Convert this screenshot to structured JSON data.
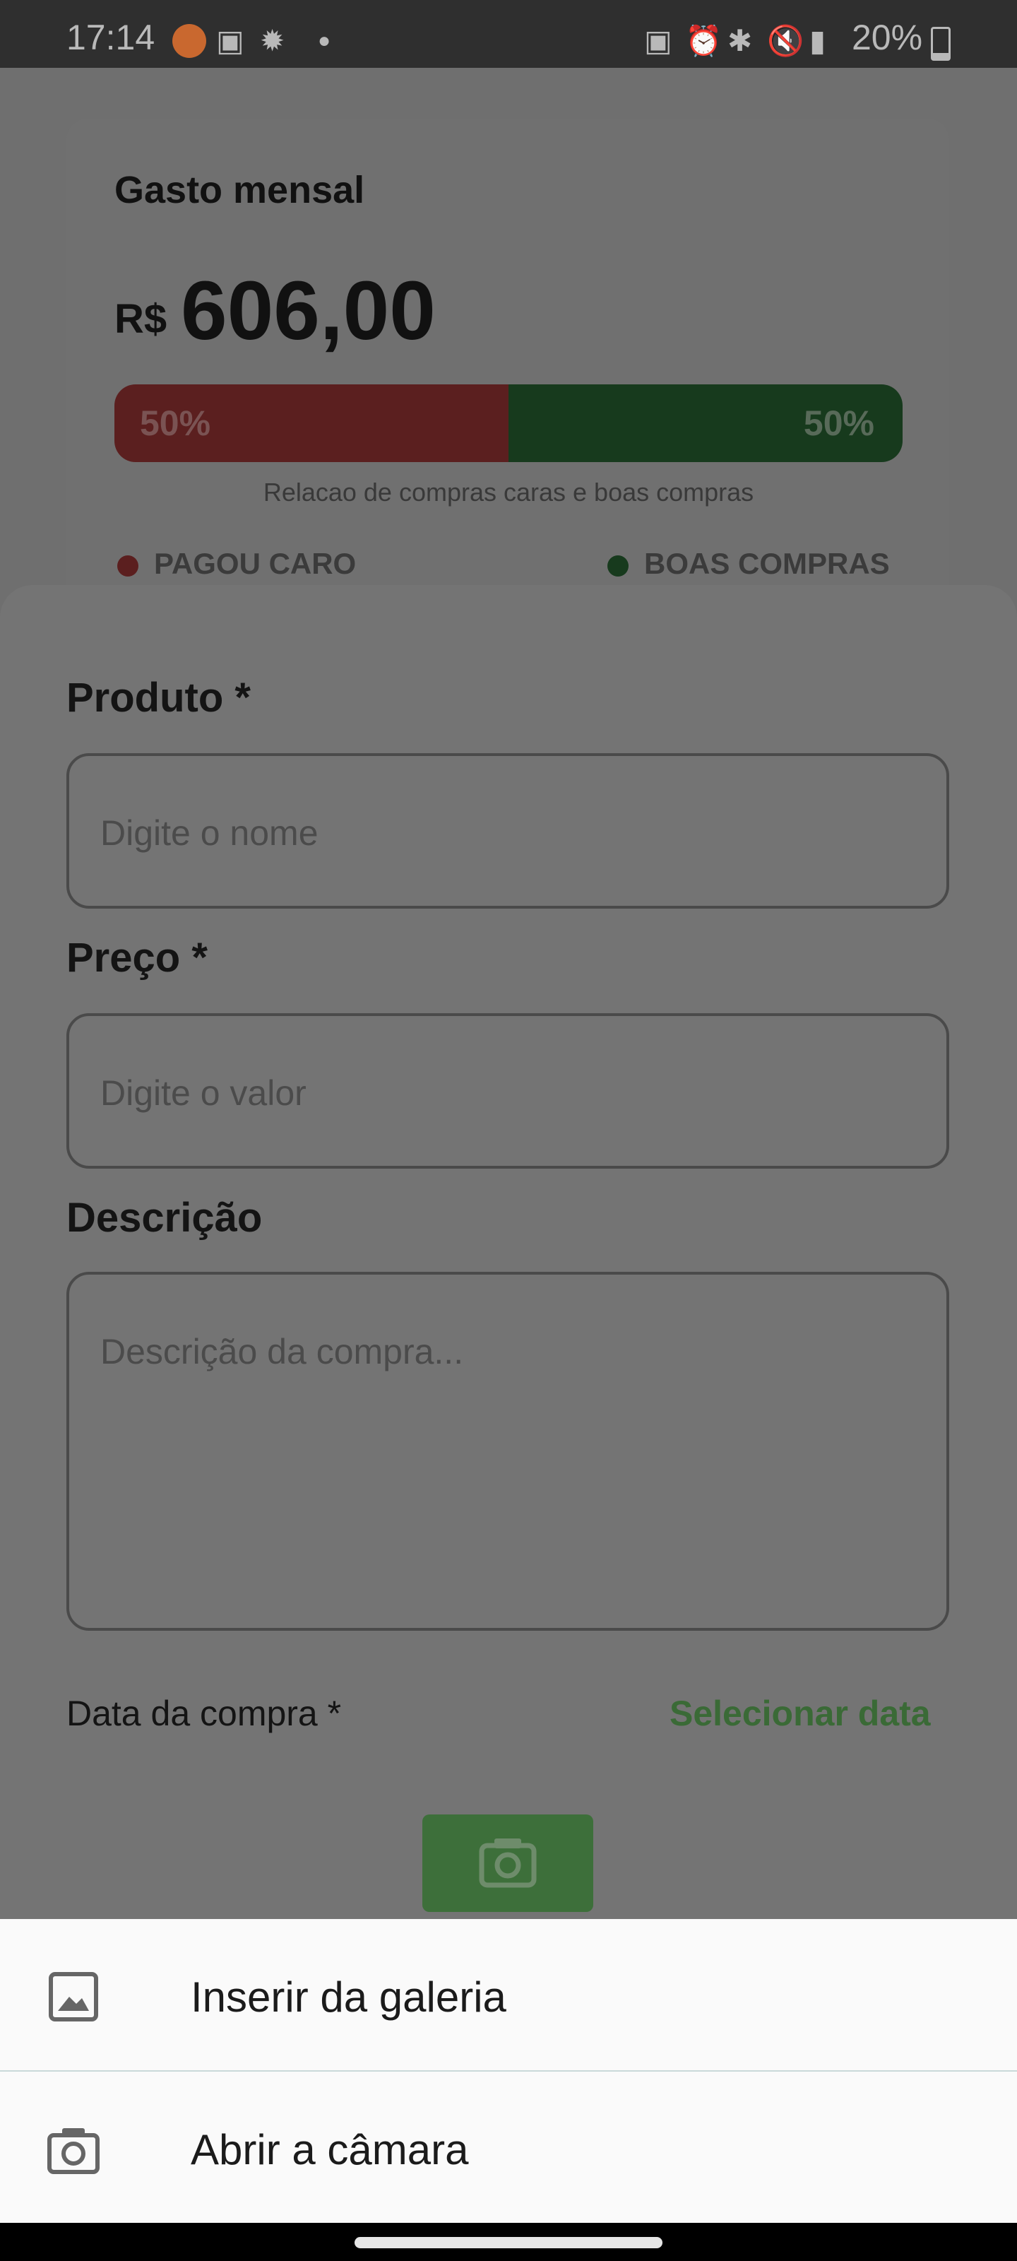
{
  "status_bar": {
    "time": "17:14",
    "battery_percent": "20%",
    "icons": [
      "app-notification-icon",
      "gallery-icon",
      "fan-icon",
      "dot-icon",
      "lock-icon",
      "alarm-icon",
      "bluetooth-icon",
      "mute-icon",
      "signal-icon",
      "battery-icon"
    ]
  },
  "summary_card": {
    "title": "Gasto mensal",
    "currency": "R$",
    "amount": "606,00",
    "expensive_percent_label": "50%",
    "good_percent_label": "50%",
    "expensive_share": 0.5,
    "caption": "Relacao de compras caras e boas compras",
    "legend_expensive": "PAGOU CARO",
    "legend_good": "BOAS COMPRAS"
  },
  "form": {
    "product_label": "Produto *",
    "product_placeholder": "Digite o nome",
    "price_label": "Preço *",
    "price_placeholder": "Digite o valor",
    "description_label": "Descrição",
    "description_placeholder": "Descrição da compra...",
    "date_label": "Data da compra *",
    "select_date": "Selecionar data",
    "camera_button_icon": "camera-icon"
  },
  "image_menu": {
    "gallery": "Inserir da galeria",
    "camera": "Abrir a câmara"
  },
  "colors": {
    "accent_green": "#3d6f3a",
    "expensive_red": "#5b1f1f",
    "good_green": "#173a1d"
  }
}
